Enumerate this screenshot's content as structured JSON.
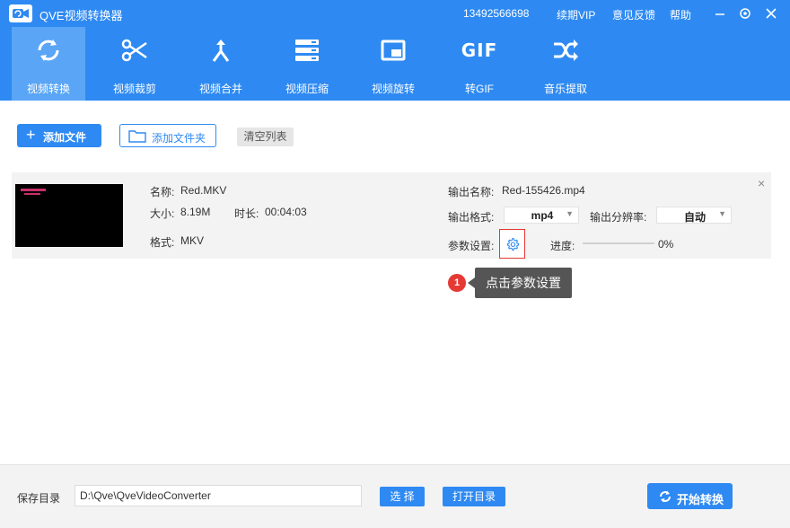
{
  "app": {
    "title": "QVE视频转换器"
  },
  "titlebar": {
    "phone": "13492566698",
    "vip": "续期VIP",
    "feedback": "意见反馈",
    "help": "帮助"
  },
  "toolbar": {
    "items": [
      {
        "label": "视频转换",
        "icon": "convert-icon",
        "active": true
      },
      {
        "label": "视频裁剪",
        "icon": "scissors-icon"
      },
      {
        "label": "视频合并",
        "icon": "merge-icon"
      },
      {
        "label": "视频压缩",
        "icon": "compress-icon"
      },
      {
        "label": "视频旋转",
        "icon": "rotate-icon"
      },
      {
        "label": "转GIF",
        "icon": "gif-icon",
        "icon_text": "GIF"
      },
      {
        "label": "音乐提取",
        "icon": "shuffle-icon"
      }
    ]
  },
  "actions": {
    "add_file": "添加文件",
    "add_folder": "添加文件夹",
    "clear_list": "清空列表"
  },
  "file": {
    "name_label": "名称:",
    "name": "Red.MKV",
    "size_label": "大小:",
    "size": "8.19M",
    "duration_label": "时长:",
    "duration": "00:04:03",
    "format_label": "格式:",
    "format": "MKV",
    "output_name_label": "输出名称:",
    "output_name": "Red-155426.mp4",
    "output_format_label": "输出格式:",
    "output_format": "mp4",
    "output_resolution_label": "输出分辨率:",
    "output_resolution": "自动",
    "params_label": "参数设置:",
    "progress_label": "进度:",
    "progress_text": "0%",
    "progress": 0
  },
  "tooltip": {
    "step": "1",
    "text": "点击参数设置"
  },
  "bottom": {
    "save_label": "保存目录",
    "save_path": "D:\\Qve\\QveVideoConverter",
    "select": "选 择",
    "open_dir": "打开目录",
    "start": "开始转换"
  },
  "colors": {
    "primary": "#2e8af2",
    "active_tab": "#5aa5f6",
    "highlight": "#e53935"
  }
}
